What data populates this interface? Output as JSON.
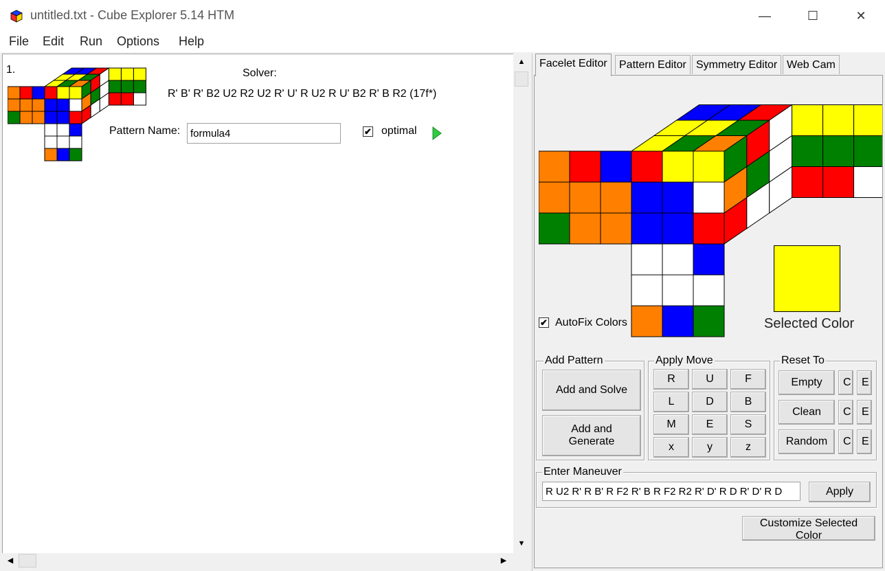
{
  "window": {
    "title": "untitled.txt - Cube Explorer 5.14 HTM",
    "controls": [
      "—",
      "☐",
      "✕"
    ]
  },
  "menu": [
    "File",
    "Edit",
    "Run",
    "Options",
    "Help"
  ],
  "colors": {
    "W": "#ffffff",
    "Y": "#ffff00",
    "R": "#ff0000",
    "O": "#ff8000",
    "B": "#0000ff",
    "G": "#008000"
  },
  "result": {
    "index": "1.",
    "solver_label": "Solver:",
    "solution": "R' B' R' B2 U2 R2 U2 R' U' R U2 R U' B2 R' B R2  (17f*)",
    "pattern_name_label": "Pattern Name:",
    "pattern_name_value": "formula4",
    "optimal_label": "optimal",
    "optimal_checked": "✔"
  },
  "cube": {
    "U": [
      "B",
      "B",
      "R",
      "Y",
      "Y",
      "G",
      "Y",
      "G",
      "O"
    ],
    "F": [
      "R",
      "Y",
      "Y",
      "B",
      "B",
      "W",
      "B",
      "B",
      "R"
    ],
    "L": [
      "O",
      "R",
      "B",
      "O",
      "O",
      "O",
      "G",
      "O",
      "O"
    ],
    "D": [
      "W",
      "W",
      "B",
      "W",
      "W",
      "W",
      "O",
      "B",
      "G"
    ],
    "Rside": [
      "G",
      "R",
      "W",
      "O",
      "G",
      "W",
      "R",
      "W",
      "W"
    ],
    "flat": [
      "Y",
      "Y",
      "Y",
      "G",
      "G",
      "G",
      "R",
      "R",
      "W"
    ]
  },
  "tabs": [
    "Facelet Editor",
    "Pattern Editor",
    "Symmetry Editor",
    "Web Cam"
  ],
  "facelet": {
    "autofix_label": "AutoFix Colors",
    "autofix_checked": "✔",
    "selected_color_label": "Selected Color",
    "selected_color": "#ffff00"
  },
  "add_pattern": {
    "title": "Add Pattern",
    "add_and_solve": "Add and Solve",
    "add_and_generate": "Add and Generate"
  },
  "apply_move": {
    "title": "Apply Move",
    "moves": [
      "R",
      "U",
      "F",
      "L",
      "D",
      "B",
      "M",
      "E",
      "S",
      "x",
      "y",
      "z"
    ]
  },
  "reset_to": {
    "title": "Reset To",
    "rows": [
      {
        "label": "Empty",
        "c": "C",
        "e": "E"
      },
      {
        "label": "Clean",
        "c": "C",
        "e": "E"
      },
      {
        "label": "Random",
        "c": "C",
        "e": "E"
      }
    ]
  },
  "maneuver": {
    "title": "Enter Maneuver",
    "value": "R U2 R' R B' R F2 R' B R F2 R2 R' D' R D R' D' R D",
    "apply_label": "Apply"
  },
  "customize_label": "Customize Selected Color",
  "scroll": {
    "up": "▲",
    "down": "▼",
    "left": "◀",
    "right": "▶"
  }
}
